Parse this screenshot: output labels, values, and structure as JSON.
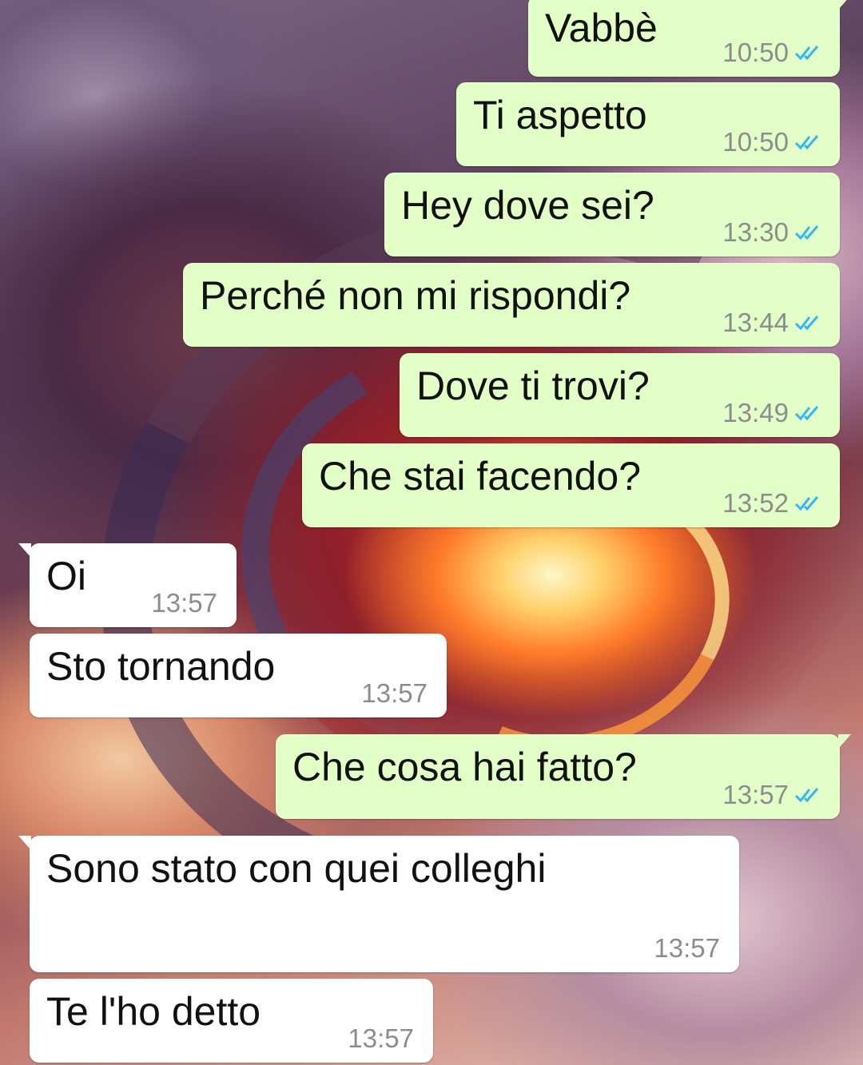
{
  "chat": {
    "outgoing_bubble_color": "#e1ffc7",
    "incoming_bubble_color": "#ffffff",
    "read_check_color": "#34b7f1",
    "messages": [
      {
        "direction": "out",
        "text": "Vabbè",
        "time": "10:50",
        "status_icon": "double-check-read-icon"
      },
      {
        "direction": "out",
        "text": "Ti aspetto",
        "time": "10:50",
        "status_icon": "double-check-read-icon"
      },
      {
        "direction": "out",
        "text": "Hey dove sei?",
        "time": "13:30",
        "status_icon": "double-check-read-icon"
      },
      {
        "direction": "out",
        "text": "Perché non mi rispondi?",
        "time": "13:44",
        "status_icon": "double-check-read-icon"
      },
      {
        "direction": "out",
        "text": "Dove ti trovi?",
        "time": "13:49",
        "status_icon": "double-check-read-icon"
      },
      {
        "direction": "out",
        "text": "Che stai facendo?",
        "time": "13:52",
        "status_icon": "double-check-read-icon"
      },
      {
        "direction": "in",
        "text": "Oi",
        "time": "13:57"
      },
      {
        "direction": "in",
        "text": "Sto tornando",
        "time": "13:57"
      },
      {
        "direction": "out",
        "text": "Che cosa hai fatto?",
        "time": "13:57",
        "status_icon": "double-check-read-icon"
      },
      {
        "direction": "in",
        "text": "Sono stato con quei colleghi",
        "time": "13:57"
      },
      {
        "direction": "in",
        "text": "Te l'ho detto",
        "time": "13:57"
      }
    ]
  }
}
